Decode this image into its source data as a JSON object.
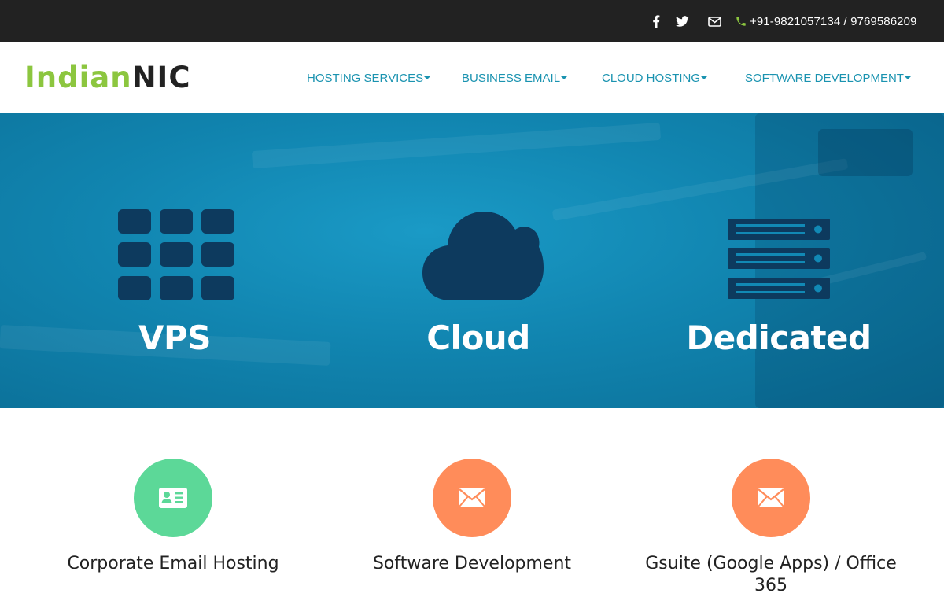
{
  "topbar": {
    "icons": [
      "facebook-icon",
      "twitter-icon",
      "mail-icon"
    ],
    "phone": "+91-9821057134 / 9769586209"
  },
  "header": {
    "logo_part1": "Indian",
    "logo_part2": "NIC",
    "nav": [
      {
        "label": "HOSTING SERVICES"
      },
      {
        "label": "BUSINESS EMAIL"
      },
      {
        "label": "CLOUD HOSTING"
      },
      {
        "label": "SOFTWARE DEVELOPMENT"
      }
    ]
  },
  "hero": {
    "items": [
      {
        "label": "VPS",
        "icon": "grid-icon"
      },
      {
        "label": "Cloud",
        "icon": "cloud-icon"
      },
      {
        "label": "Dedicated",
        "icon": "server-icon"
      }
    ]
  },
  "services": [
    {
      "title": "Corporate Email Hosting",
      "icon": "id-card-icon",
      "color": "#5cd898"
    },
    {
      "title": "Software Development",
      "icon": "envelope-icon",
      "color": "#ff8c5a"
    },
    {
      "title": "Gsuite (Google Apps) / Office 365",
      "icon": "envelope-icon",
      "color": "#ff8c5a"
    }
  ],
  "colors": {
    "topbar_bg": "#222222",
    "nav_text": "#1a93b0",
    "logo_green": "#8cc63f",
    "hero_icon": "#0d3a5e",
    "phone_icon": "#8cc63f"
  }
}
